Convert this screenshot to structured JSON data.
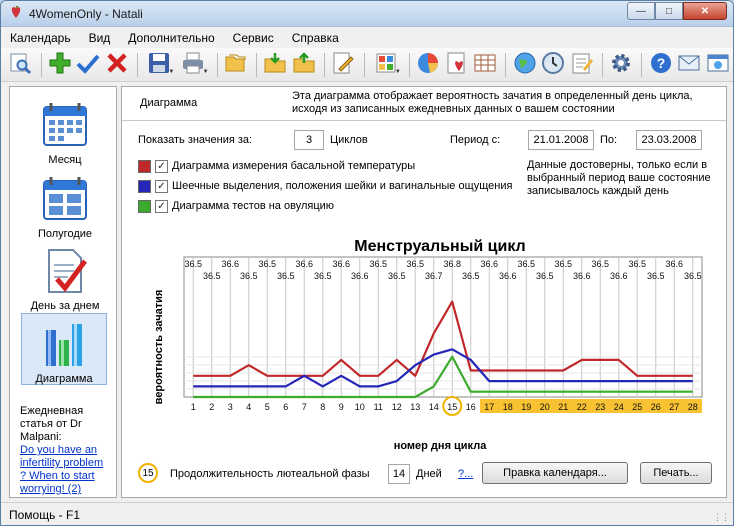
{
  "window": {
    "title": "4WomenOnly - Natali"
  },
  "menu": [
    "Календарь",
    "Вид",
    "Дополнительно",
    "Сервис",
    "Справка"
  ],
  "toolbar_icons": [
    "find-icon",
    "add-icon",
    "check-icon",
    "delete-icon",
    "save-icon",
    "print-icon",
    "copy-icon",
    "import-icon",
    "export-icon",
    "edit-icon",
    "color-chart-icon",
    "pie-chart-icon",
    "heart-document-icon",
    "table-icon",
    "globe-icon",
    "clock-icon",
    "notepad-icon",
    "settings-icon",
    "help-icon",
    "mail-icon",
    "web-icon"
  ],
  "sidebar": {
    "items": [
      {
        "label": "Месяц",
        "icon": "month-calendar-icon"
      },
      {
        "label": "Полугодие",
        "icon": "half-year-calendar-icon"
      },
      {
        "label": "День за днем",
        "icon": "day-by-day-icon"
      },
      {
        "label": "Диаграмма",
        "icon": "diagram-icon"
      }
    ],
    "article_title": "Ежедневная статья от Dr Malpani:",
    "article_link_1": "Do you have an infertility problem",
    "article_link_2": "? When to start worrying! (2)"
  },
  "header": {
    "title": "Диаграмма",
    "description": "Эта диаграмма отображает вероятность зачатия в определенный день цикла, исходя из записанных ежедневных данных о вашем состоянии"
  },
  "controls": {
    "show_label": "Показать значения за:",
    "cycles_value": "3",
    "cycles_label": "Циклов",
    "period_label": "Период с:",
    "date_from": "21.01.2008",
    "to_label": "По:",
    "date_to": "23.03.2008",
    "note": "Данные достоверны, только если в выбранный период ваше состояние записывалось каждый день",
    "check_mark": "✓",
    "legend": [
      {
        "label": "Диаграмма измерения басальной температуры",
        "color": "#c0282a"
      },
      {
        "label": "Шеечные выделения, положения шейки и вагинальные ощущения",
        "color": "#2525b8"
      },
      {
        "label": "Диаграмма тестов на овуляцию",
        "color": "#3caa2c"
      }
    ]
  },
  "chart_data": {
    "type": "line",
    "title": "Менструальный цикл",
    "xlabel": "номер дня цикла",
    "ylabel": "вероятность зачатия",
    "x": [
      1,
      2,
      3,
      4,
      5,
      6,
      7,
      8,
      9,
      10,
      11,
      12,
      13,
      14,
      15,
      16,
      17,
      18,
      19,
      20,
      21,
      22,
      23,
      24,
      25,
      26,
      27,
      28
    ],
    "top_labels": [
      "36.5",
      "36.5",
      "36.6",
      "36.5",
      "36.5",
      "36.5",
      "36.6",
      "36.5",
      "36.6",
      "36.6",
      "36.5",
      "36.5",
      "36.5",
      "36.7",
      "36.8",
      "36.5",
      "36.6",
      "36.6",
      "36.5",
      "36.5",
      "36.5",
      "36.6",
      "36.5",
      "36.6",
      "36.5",
      "36.5",
      "36.6",
      "36.5"
    ],
    "series": [
      {
        "name": "Диаграмма измерения басальной температуры",
        "color": "#c0282a",
        "values": [
          0.2,
          0.2,
          0.2,
          0.3,
          0.2,
          0.2,
          0.2,
          0.2,
          0.35,
          0.2,
          0.2,
          0.35,
          0.2,
          0.6,
          0.9,
          0.25,
          0.25,
          0.25,
          0.25,
          0.25,
          0.25,
          0.35,
          0.35,
          0.35,
          0.2,
          0.2,
          0.2,
          0.2
        ]
      },
      {
        "name": "Шеечные выделения, положения шейки и вагинальные ощущения",
        "color": "#2525b8",
        "values": [
          0.1,
          0.1,
          0.1,
          0.1,
          0.1,
          0.1,
          0.2,
          0.1,
          0.2,
          0.1,
          0.1,
          0.15,
          0.3,
          0.4,
          0.45,
          0.35,
          0.15,
          0.15,
          0.15,
          0.15,
          0.15,
          0.15,
          0.15,
          0.15,
          0.15,
          0.15,
          0.15,
          0.15
        ]
      },
      {
        "name": "Диаграмма тестов на овуляцию",
        "color": "#3caa2c",
        "values": [
          0,
          0,
          0,
          0,
          0,
          0,
          0,
          0,
          0,
          0,
          0,
          0,
          0,
          0.1,
          0.38,
          0.05,
          0.05,
          0.05,
          0.05,
          0.05,
          0.05,
          0.05,
          0.05,
          0.05,
          0.05,
          0.05,
          0.05,
          0.05
        ]
      }
    ],
    "highlight_day": 15,
    "fertile_days_from": 17,
    "ylim": [
      0,
      1
    ],
    "grid": "vertical"
  },
  "bottom": {
    "circle_value": "15",
    "luteal_label": "Продолжительность лютеальной фазы",
    "luteal_value": "14",
    "days_label": "Дней",
    "help_link": "?...",
    "edit_button": "Правка календаря...",
    "print_button": "Печать..."
  },
  "status": {
    "text": "Помощь - F1"
  }
}
